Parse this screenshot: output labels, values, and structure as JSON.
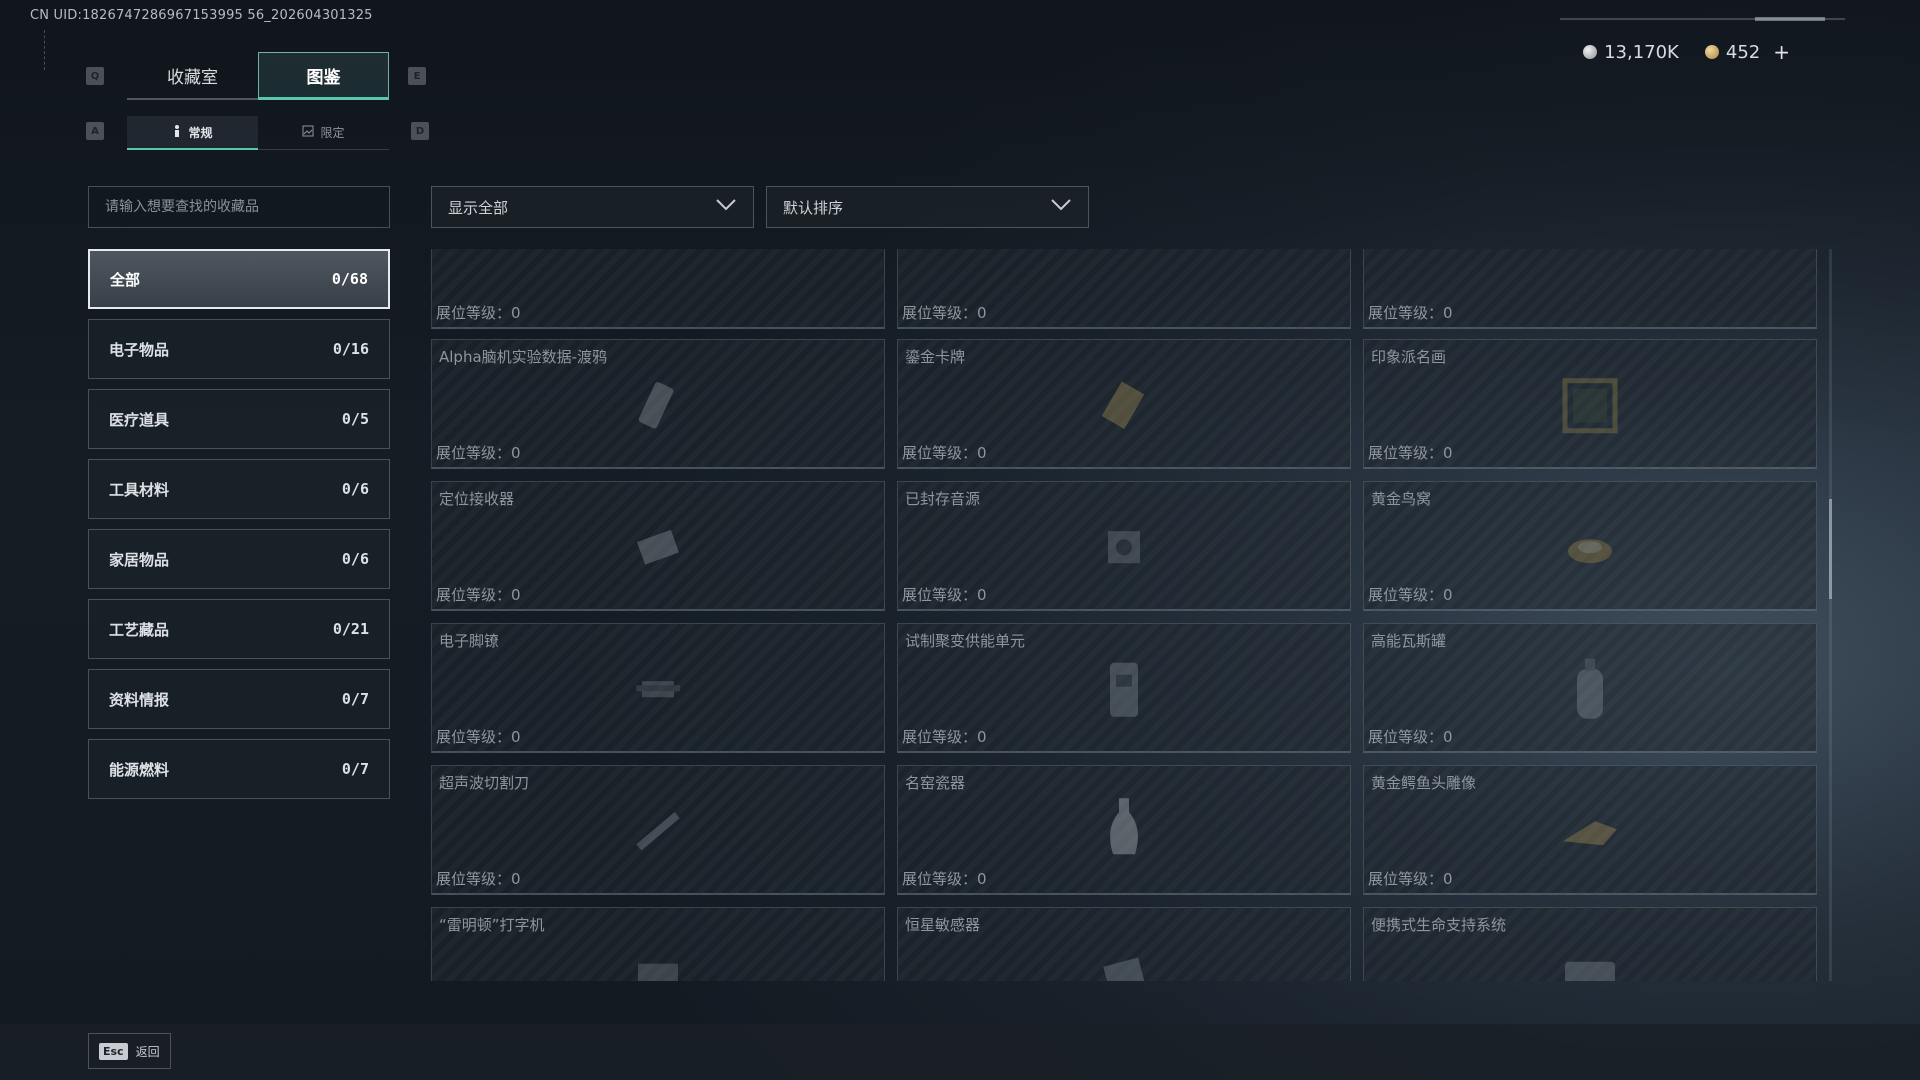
{
  "uid": "CN UID:1826747286967153995 56_202604301325",
  "currency": {
    "silver": "13,170K",
    "gold": "452",
    "add": "+",
    "silver_icon": "silver-coin-icon",
    "gold_icon": "gold-coin-icon"
  },
  "keys": {
    "q": "Q",
    "e": "E",
    "a": "A",
    "d": "D",
    "esc": "Esc"
  },
  "tabs_main": [
    {
      "label": "收藏室"
    },
    {
      "label": "图鉴",
      "active": true
    }
  ],
  "tabs_sub": [
    {
      "label": "常规",
      "active": true,
      "icon": "figure-icon"
    },
    {
      "label": "限定",
      "icon": "picture-icon"
    }
  ],
  "search": {
    "placeholder": "请输入想要查找的收藏品"
  },
  "filters": {
    "display": "显示全部",
    "sort": "默认排序"
  },
  "categories": [
    {
      "label": "全部",
      "count": "0/68",
      "active": true
    },
    {
      "label": "电子物品",
      "count": "0/16"
    },
    {
      "label": "医疗道具",
      "count": "0/5"
    },
    {
      "label": "工具材料",
      "count": "0/6"
    },
    {
      "label": "家居物品",
      "count": "0/6"
    },
    {
      "label": "工艺藏品",
      "count": "0/21"
    },
    {
      "label": "资料情报",
      "count": "0/7"
    },
    {
      "label": "能源燃料",
      "count": "0/7"
    }
  ],
  "cards": [
    {
      "name": "",
      "level": "展位等级：0"
    },
    {
      "name": "",
      "level": "展位等级：0"
    },
    {
      "name": "",
      "level": "展位等级：0"
    },
    {
      "name": "Alpha脑机实验数据-渡鸦",
      "level": "展位等级：0"
    },
    {
      "name": "鎏金卡牌",
      "level": "展位等级：0"
    },
    {
      "name": "印象派名画",
      "level": "展位等级：0"
    },
    {
      "name": "定位接收器",
      "level": "展位等级：0"
    },
    {
      "name": "已封存音源",
      "level": "展位等级：0"
    },
    {
      "name": "黄金鸟窝",
      "level": "展位等级：0"
    },
    {
      "name": "电子脚镣",
      "level": "展位等级：0"
    },
    {
      "name": "试制聚变供能单元",
      "level": "展位等级：0"
    },
    {
      "name": "高能瓦斯罐",
      "level": "展位等级：0"
    },
    {
      "name": "超声波切割刀",
      "level": "展位等级：0"
    },
    {
      "name": "名窑瓷器",
      "level": "展位等级：0"
    },
    {
      "name": "黄金鳄鱼头雕像",
      "level": "展位等级：0"
    },
    {
      "name": "“雷明顿”打字机",
      "level": ""
    },
    {
      "name": "恒星敏感器",
      "level": ""
    },
    {
      "name": "便携式生命支持系统",
      "level": ""
    }
  ],
  "back": {
    "label": "返回"
  }
}
